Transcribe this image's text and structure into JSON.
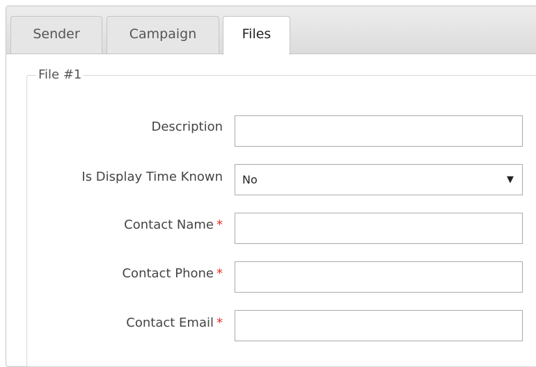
{
  "tabs": [
    {
      "label": "Sender"
    },
    {
      "label": "Campaign"
    },
    {
      "label": "Files"
    }
  ],
  "active_tab": "Files",
  "fieldset": {
    "legend": "File #1"
  },
  "form": {
    "description": {
      "label": "Description",
      "value": "",
      "required": false
    },
    "display_time_known": {
      "label": "Is Display Time Known",
      "value": "No"
    },
    "contact_name": {
      "label": "Contact Name",
      "value": "",
      "required": true
    },
    "contact_phone": {
      "label": "Contact Phone",
      "value": "",
      "required": true
    },
    "contact_email": {
      "label": "Contact Email",
      "value": "",
      "required": true
    },
    "required_marker": "*"
  },
  "icons": {
    "select_caret": "▼"
  },
  "colors": {
    "required": "#e0312a"
  }
}
